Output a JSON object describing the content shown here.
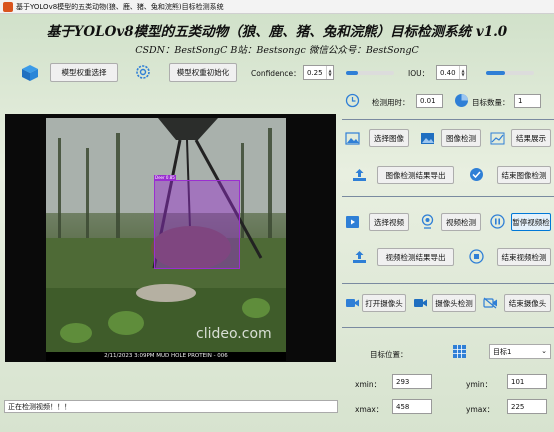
{
  "window": {
    "title": "基于YOLOv8模型的五类动物(狼、鹿、猪、兔和浣熊)目标检测系统"
  },
  "header": {
    "title": "基于YOLOv8模型的五类动物（狼、鹿、猪、兔和浣熊）目标检测系统 v1.0",
    "subtitle": "CSDN：BestSongC   B站：Bestsongc   微信公众号：BestSongC"
  },
  "toolbar": {
    "select_weights": "模型权重选择",
    "init_weights": "模型权重初始化",
    "confidence_label": "Confidence：",
    "confidence_value": "0.25",
    "confidence_fraction": 0.25,
    "iou_label": "IOU：",
    "iou_value": "0.40",
    "iou_fraction": 0.4
  },
  "stats": {
    "time_label": "检测用时：",
    "time_value": "0.01",
    "count_label": "目标数量：",
    "count_value": "1"
  },
  "image_section": {
    "select_image": "选择图像",
    "detect_image": "图像检测",
    "show_result": "结果展示",
    "export_result": "图像检测结果导出",
    "end_detect": "结束图像检测"
  },
  "video_section": {
    "select_video": "选择视频",
    "detect_video": "视频检测",
    "pause_video": "暂停视频检",
    "export_result": "视频检测结果导出",
    "end_detect": "结束视频检测"
  },
  "camera_section": {
    "open_camera": "打开摄像头",
    "detect_camera": "摄像头检测",
    "close_camera": "结束摄像头"
  },
  "target": {
    "position_label": "目标位置：",
    "selected": "目标1",
    "xmin_label": "xmin：",
    "xmin_value": "293",
    "ymin_label": "ymin：",
    "ymin_value": "101",
    "xmax_label": "xmax：",
    "xmax_value": "458",
    "ymax_label": "ymax：",
    "ymax_value": "225"
  },
  "video": {
    "detection_label": "Deer 0.85",
    "camera_stamp": "2/11/2023   3:09PM   MUD HOLE PROTEIN - 006",
    "watermark": "clideo.com"
  },
  "status": {
    "text": "正在检测视频！！！"
  },
  "colors": {
    "accent": "#2f7fd6",
    "detection_box": "#9a2fd0"
  }
}
